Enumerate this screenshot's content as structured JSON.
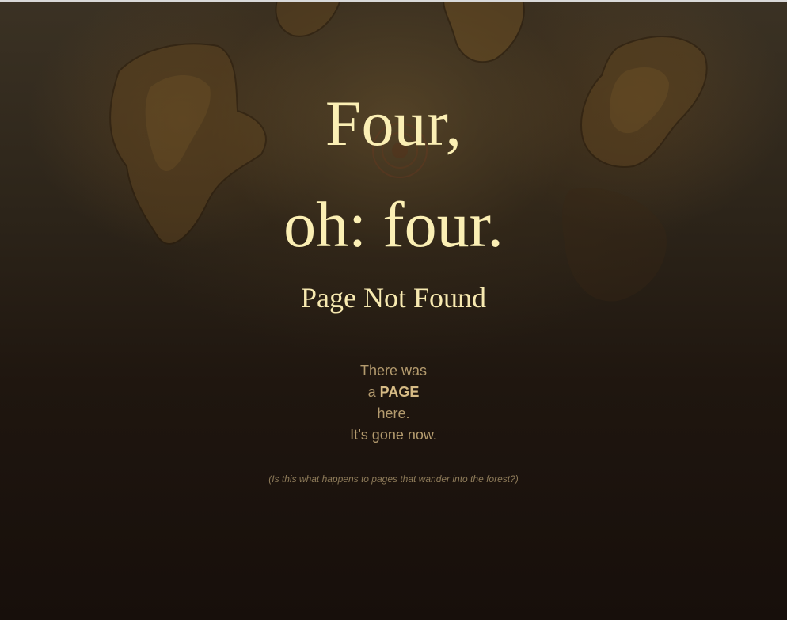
{
  "heading": {
    "line1": "Four,",
    "line2": "oh: four."
  },
  "subtitle": "Page Not Found",
  "message": {
    "line1": "There was",
    "line2_prefix": "a",
    "line2_emphasis": "PAGE",
    "line3": "here.",
    "line4": "It’s gone now."
  },
  "note": "(Is this what happens to pages that wander into the forest?)",
  "colors": {
    "heading": "#fbefb4",
    "message": "#b49b6e",
    "note": "#8d7a59",
    "background": "#1a110c"
  }
}
